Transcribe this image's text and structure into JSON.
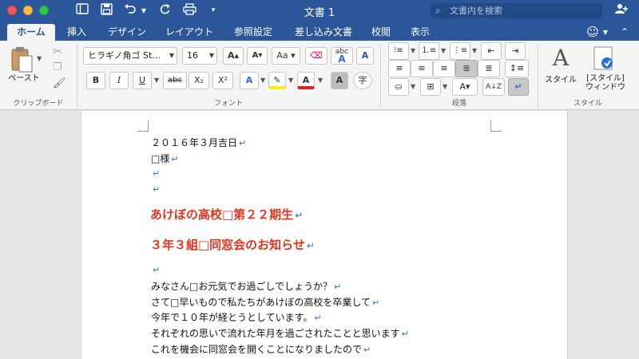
{
  "window": {
    "title": "文書 1",
    "search_placeholder": "文書内を検索"
  },
  "tabs": [
    "ホーム",
    "挿入",
    "デザイン",
    "レイアウト",
    "参照設定",
    "差し込み文書",
    "校閲",
    "表示"
  ],
  "active_tab": "ホーム",
  "ribbon": {
    "clipboard": {
      "paste_label": "ペースト",
      "group_label": "クリップボード"
    },
    "font": {
      "font_name": "ヒラギノ角ゴ St...",
      "font_size": "16",
      "group_label": "フォント",
      "bold": "B",
      "italic": "I",
      "underline": "U",
      "strike": "abc",
      "subscript": "X₂",
      "superscript": "X²",
      "phonetic": "字",
      "change_case": "Aa",
      "clear": "abc"
    },
    "paragraph": {
      "group_label": "段落"
    },
    "styles": {
      "styles_label": "スタイル",
      "styles_pane_label": "[スタイル]\nウィンドウ",
      "group_label": "スタイル"
    }
  },
  "document": {
    "lines": [
      "２０１６年３月吉日",
      "□様",
      "",
      "",
      "あけぼの高校□第２２期生",
      "３年３組□同窓会のお知らせ",
      "",
      "みなさん□お元気でお過ごしでしょうか？",
      "さて□早いもので私たちがあけぼの高校を卒業して",
      "今年で１０年が経とうとしています。",
      "それぞれの思いで流れた年月を過ごされたことと思います",
      "これを機会に同窓会を開くことになりましたので"
    ],
    "paragraph_mark": "↵"
  },
  "colors": {
    "accent": "#2b579a",
    "heading": "#e8331c",
    "paragraph_mark": "#2b6fd6"
  }
}
